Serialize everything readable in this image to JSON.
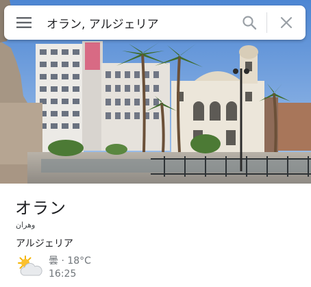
{
  "search": {
    "query": "オラン, アルジェリア",
    "menu_icon": "hamburger-menu-icon",
    "search_icon": "search-icon",
    "close_icon": "close-icon"
  },
  "hero": {
    "description_icon": "city-photo"
  },
  "place": {
    "name": "オラン",
    "native_name": "وهران",
    "country": "アルジェリア"
  },
  "weather": {
    "icon": "partly-cloudy-icon",
    "condition_temp": "曇 · 18°C",
    "time": "16:25"
  },
  "colors": {
    "sky": "#5b8fd6",
    "text_primary": "#202124",
    "text_secondary": "#70757a",
    "icon_gray": "#5f6368"
  }
}
